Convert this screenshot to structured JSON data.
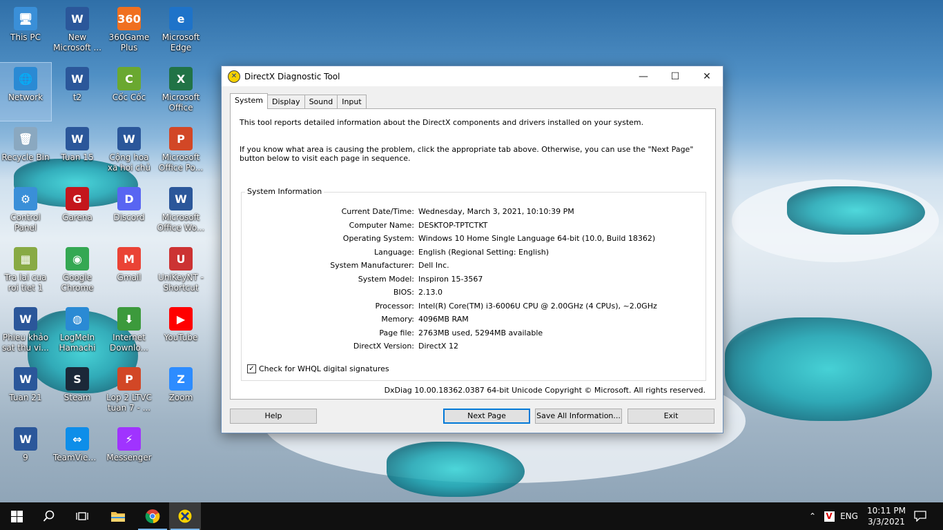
{
  "desktop": {
    "icons": [
      {
        "label": "This PC",
        "glyph": "🖥"
      },
      {
        "label": "New Microsoft ...",
        "glyph": "W"
      },
      {
        "label": "360Game Plus",
        "glyph": "360"
      },
      {
        "label": "Microsoft Edge",
        "glyph": "e"
      },
      {
        "label": "Network",
        "glyph": "🌐"
      },
      {
        "label": "t2",
        "glyph": "W"
      },
      {
        "label": "Cốc Cốc",
        "glyph": "C"
      },
      {
        "label": "Microsoft Office Exc...",
        "glyph": "X"
      },
      {
        "label": "Recycle Bin",
        "glyph": "🗑"
      },
      {
        "label": "Tuan 15",
        "glyph": "W"
      },
      {
        "label": "Cộng hoa xa hoi chủ ng...",
        "glyph": "W"
      },
      {
        "label": "Microsoft Office Po...",
        "glyph": "P"
      },
      {
        "label": "Control Panel",
        "glyph": "⚙"
      },
      {
        "label": "Garena",
        "glyph": "G"
      },
      {
        "label": "Discord",
        "glyph": "D"
      },
      {
        "label": "Microsoft Office Wo...",
        "glyph": "W"
      },
      {
        "label": "Tra lai cua roi tiet 1",
        "glyph": "▦"
      },
      {
        "label": "Google Chrome",
        "glyph": "◉"
      },
      {
        "label": "Gmail",
        "glyph": "M"
      },
      {
        "label": "UniKeyNT - Shortcut",
        "glyph": "U"
      },
      {
        "label": "Phieu khảo sat thu vi...",
        "glyph": "W"
      },
      {
        "label": "LogMeIn Hamachi",
        "glyph": "◍"
      },
      {
        "label": "Internet Downlo...",
        "glyph": "⬇"
      },
      {
        "label": "YouTube",
        "glyph": "▶"
      },
      {
        "label": "Tuan 21",
        "glyph": "W"
      },
      {
        "label": "Steam",
        "glyph": "S"
      },
      {
        "label": "Lop 2 LTVC tuan 7 - ...",
        "glyph": "P"
      },
      {
        "label": "Zoom",
        "glyph": "Z"
      },
      {
        "label": "9",
        "glyph": "W"
      },
      {
        "label": "TeamViewer",
        "glyph": "⇔"
      },
      {
        "label": "Messenger",
        "glyph": "⚡"
      }
    ],
    "colors": {
      "This PC": "#3a8fd8",
      "New Microsoft ...": "#2b579a",
      "360Game Plus": "#f07020",
      "Microsoft Edge": "#1e73c9",
      "Network": "#2a8ad4",
      "t2": "#2b579a",
      "Cốc Cốc": "#6aa830",
      "Microsoft Office Exc...": "#217346",
      "Recycle Bin": "#8aa8c0",
      "Tuan 15": "#2b579a",
      "Cộng hoa xa hoi chủ ng...": "#2b579a",
      "Microsoft Office Po...": "#d24726",
      "Control Panel": "#3a8fd8",
      "Garena": "#c4161c",
      "Discord": "#5865f2",
      "Microsoft Office Wo...": "#2b579a",
      "Tra lai cua roi tiet 1": "#88aa44",
      "Google Chrome": "#34a853",
      "Gmail": "#ea4335",
      "UniKeyNT - Shortcut": "#cc3333",
      "Phieu khảo sat thu vi...": "#2b579a",
      "LogMeIn Hamachi": "#2a8ad4",
      "Internet Downlo...": "#3c9a3c",
      "YouTube": "#ff0000",
      "Tuan 21": "#2b579a",
      "Steam": "#1b2838",
      "Lop 2 LTVC tuan 7 - ...": "#d24726",
      "Zoom": "#2d8cff",
      "9": "#2b579a",
      "TeamViewer": "#0e8ee9",
      "Messenger": "#a033ff"
    }
  },
  "window": {
    "title": "DirectX Diagnostic Tool",
    "tabs": [
      "System",
      "Display",
      "Sound",
      "Input"
    ],
    "intro1": "This tool reports detailed information about the DirectX components and drivers installed on your system.",
    "intro2": "If you know what area is causing the problem, click the appropriate tab above.  Otherwise, you can use the \"Next Page\" button below to visit each page in sequence.",
    "group_title": "System Information",
    "info": [
      {
        "k": "Current Date/Time:",
        "v": "Wednesday, March 3, 2021, 10:10:39 PM"
      },
      {
        "k": "Computer Name:",
        "v": "DESKTOP-TPTCTKT"
      },
      {
        "k": "Operating System:",
        "v": "Windows 10 Home Single Language 64-bit (10.0, Build 18362)"
      },
      {
        "k": "Language:",
        "v": "English (Regional Setting: English)"
      },
      {
        "k": "System Manufacturer:",
        "v": "Dell Inc."
      },
      {
        "k": "System Model:",
        "v": "Inspiron 15-3567"
      },
      {
        "k": "BIOS:",
        "v": "2.13.0"
      },
      {
        "k": "Processor:",
        "v": "Intel(R) Core(TM) i3-6006U CPU @ 2.00GHz (4 CPUs), ~2.0GHz"
      },
      {
        "k": "Memory:",
        "v": "4096MB RAM"
      },
      {
        "k": "Page file:",
        "v": "2763MB used, 5294MB available"
      },
      {
        "k": "DirectX Version:",
        "v": "DirectX 12"
      }
    ],
    "whql_label": "Check for WHQL digital signatures",
    "footer": "DxDiag 10.00.18362.0387 64-bit Unicode  Copyright © Microsoft. All rights reserved.",
    "buttons": {
      "help": "Help",
      "next": "Next Page",
      "save": "Save All Information...",
      "exit": "Exit"
    }
  },
  "taskbar": {
    "lang": "ENG",
    "time": "10:11 PM",
    "date": "3/3/2021"
  }
}
